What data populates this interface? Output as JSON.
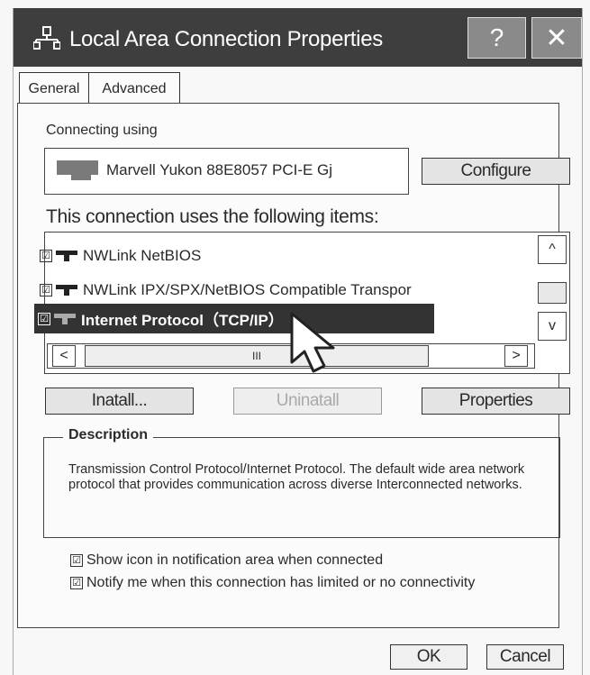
{
  "window": {
    "title": "Local Area Connection Properties",
    "help": "?",
    "close": "✕"
  },
  "tabs": [
    {
      "label": "General"
    },
    {
      "label": "Advanced"
    }
  ],
  "connecting_using_label": "Connecting using",
  "adapter_name": "Marvell Yukon 88E8057 PCI-E Gj",
  "configure_label": "Configure",
  "items_heading": "This connection uses the following items:",
  "items": [
    {
      "label": "NWLink NetBIOS",
      "checked": true
    },
    {
      "label": "NWLink IPX/SPX/NetBIOS Compatible Transpor",
      "checked": true
    },
    {
      "label": "Internet Protocol（TCP/IP）",
      "checked": true,
      "selected": true
    }
  ],
  "scroll": {
    "up": "^",
    "down": "v",
    "left": "<",
    "right": ">",
    "thumb": "III"
  },
  "buttons": {
    "install": "Inatall...",
    "uninstall": "Uninatall",
    "properties": "Properties"
  },
  "description": {
    "legend": "Description",
    "text": "Transmission Control Protocol/Internet Protocol. The default wide area network protocol that provides communication across diverse Interconnected networks."
  },
  "options": [
    {
      "label": "Show icon in notification area when connected",
      "checked": true
    },
    {
      "label": "Notify me when this connection has limited or no connectivity",
      "checked": true
    }
  ],
  "footer": {
    "ok": "OK",
    "cancel": "Cancel"
  }
}
